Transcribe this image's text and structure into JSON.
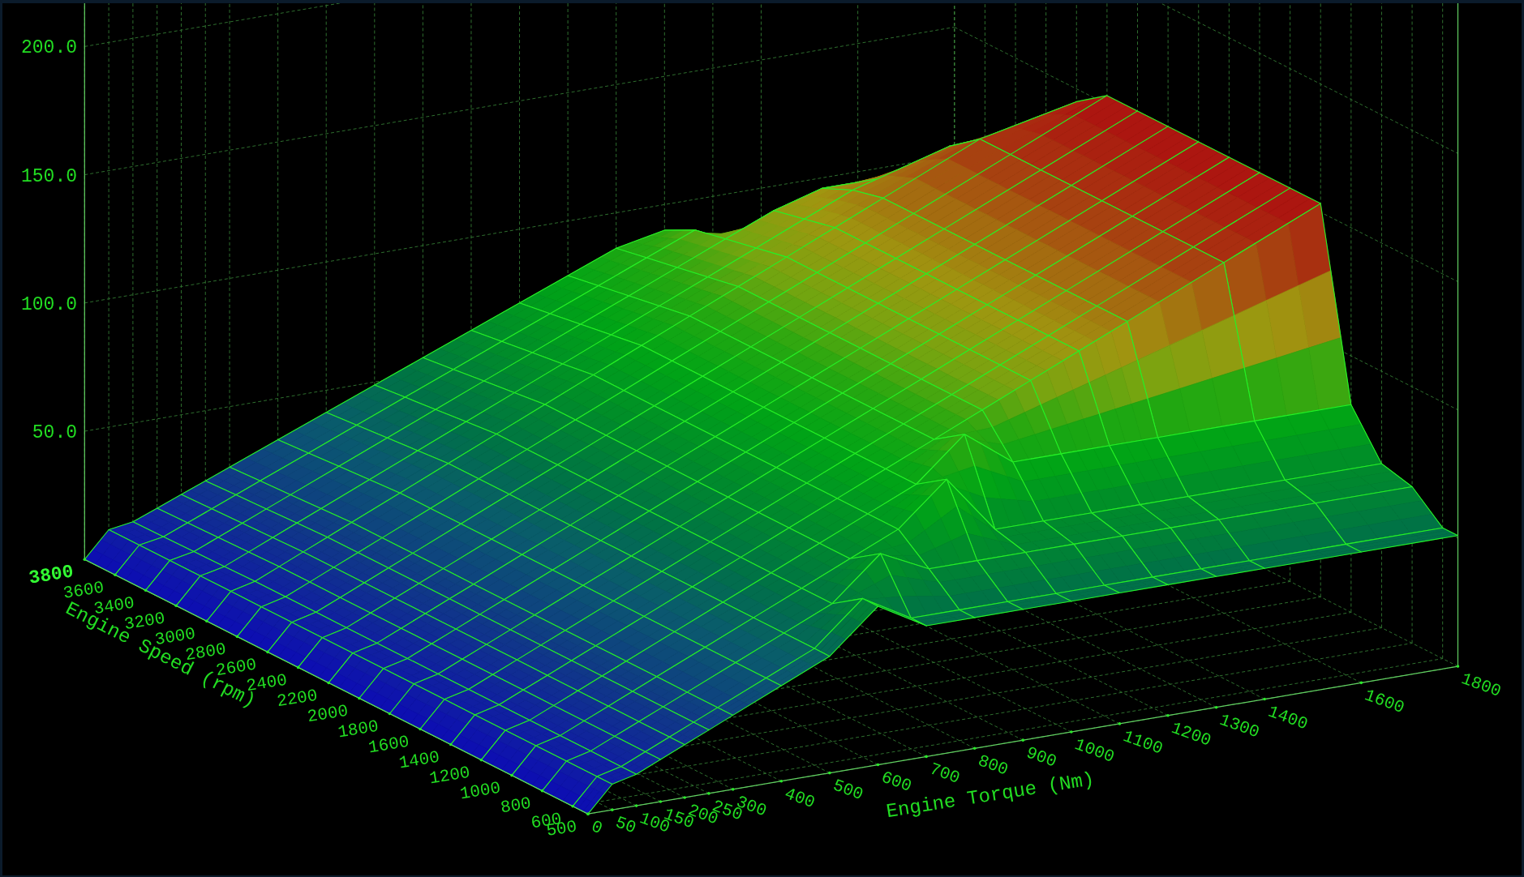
{
  "z_axis": {
    "ticks": [
      "200.0",
      "150.0",
      "100.0",
      "50.0"
    ]
  },
  "speed_axis": {
    "title": "Engine Speed (rpm)",
    "ticks": [
      "500",
      "600",
      "800",
      "1000",
      "1200",
      "1400",
      "1600",
      "1800",
      "2000",
      "2200",
      "2400",
      "2600",
      "2800",
      "3000",
      "3200",
      "3400",
      "3600",
      "3800"
    ]
  },
  "torque_axis": {
    "title": "Engine Torque (Nm)",
    "ticks": [
      "0",
      "50",
      "100",
      "150",
      "200",
      "250",
      "300",
      "400",
      "500",
      "600",
      "700",
      "800",
      "900",
      "1000",
      "1100",
      "1200",
      "1300",
      "1400",
      "1600",
      "1800"
    ]
  }
}
